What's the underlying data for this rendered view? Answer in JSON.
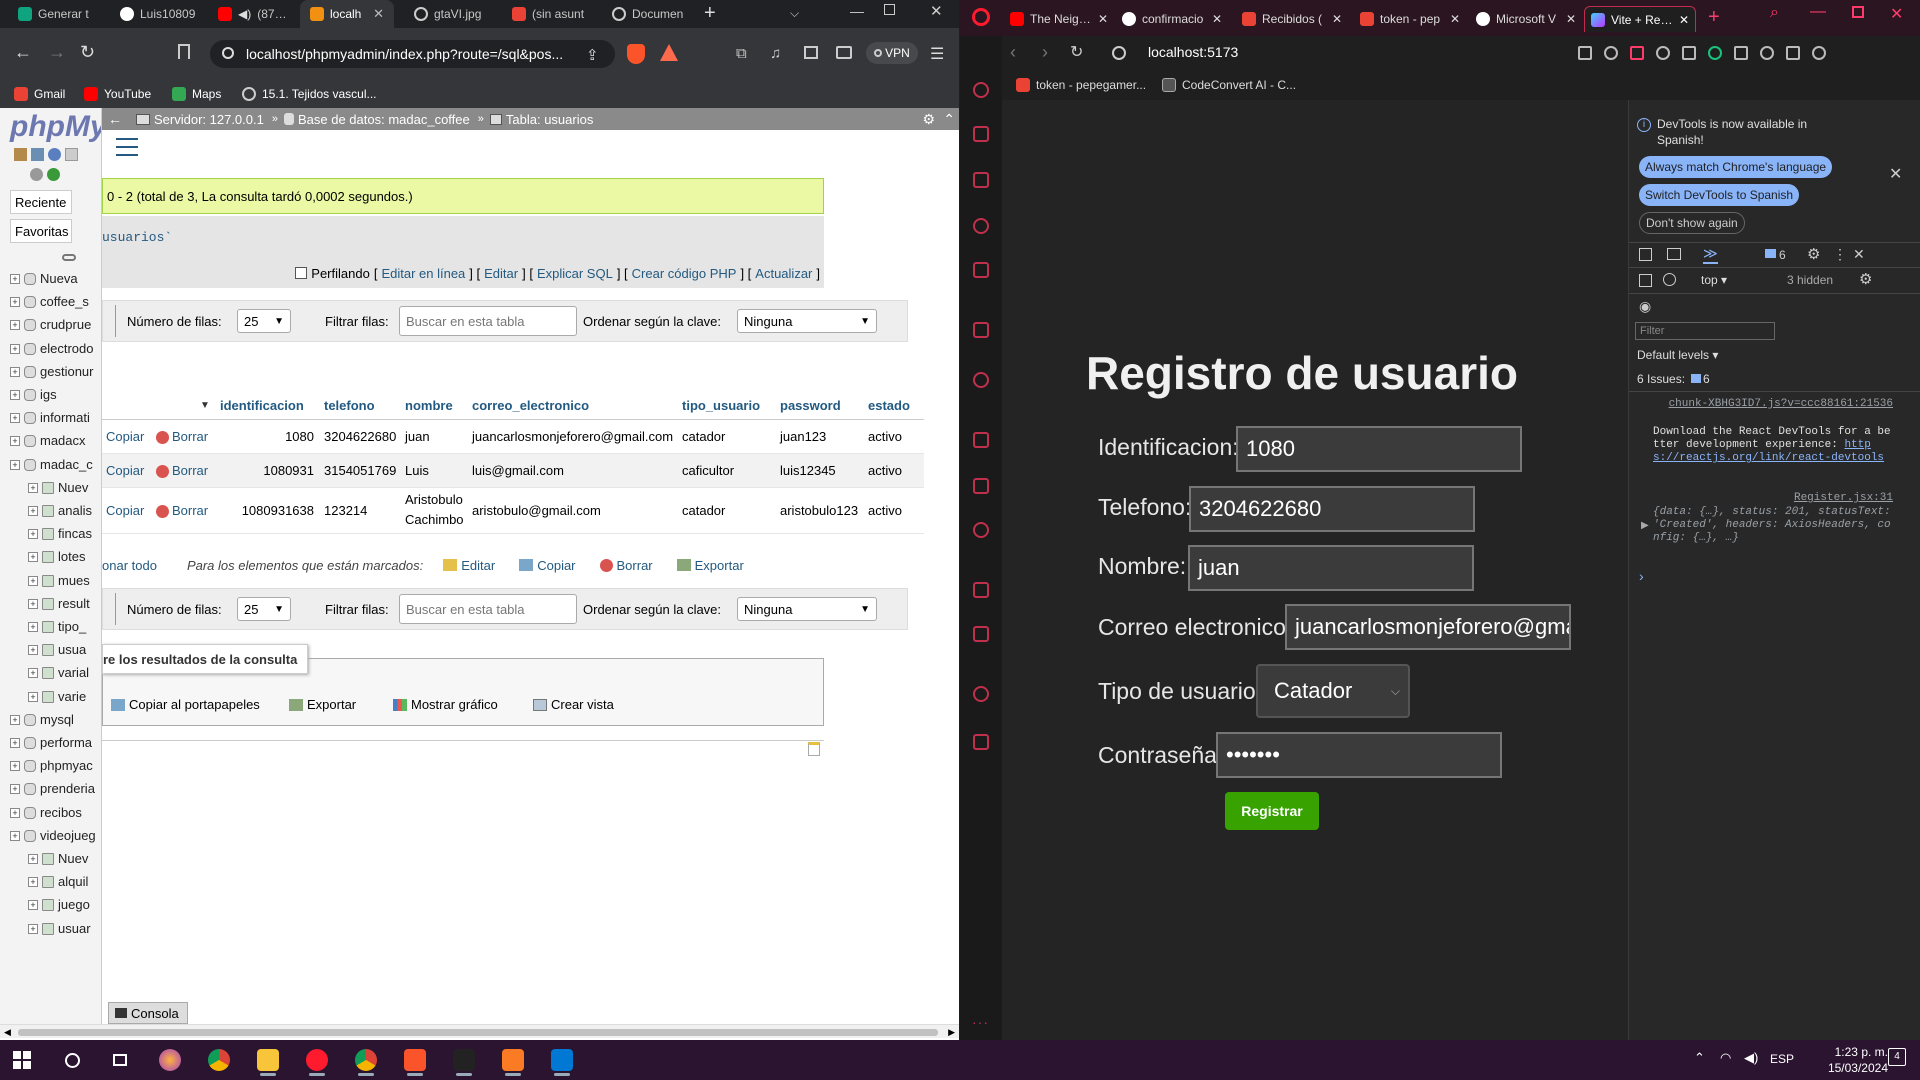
{
  "left_browser": {
    "tabs": [
      {
        "title": "Generar t"
      },
      {
        "title": "Luis10809"
      },
      {
        "title": "(87) P"
      },
      {
        "title": "localh"
      },
      {
        "title": "gtaVI.jpg"
      },
      {
        "title": "(sin asunt"
      },
      {
        "title": "Documen"
      }
    ],
    "address": "localhost/phpmyadmin/index.php?route=/sql&pos...",
    "vpn_label": "VPN",
    "bookmarks": [
      "Gmail",
      "YouTube",
      "Maps",
      "15.1. Tejidos vascul..."
    ]
  },
  "pma": {
    "logo": "phpMy",
    "nav_buttons": [
      "Reciente",
      "Favoritas"
    ],
    "tree": [
      {
        "label": "Nueva",
        "level": 0
      },
      {
        "label": "coffee_s",
        "level": 0
      },
      {
        "label": "crudprue",
        "level": 0
      },
      {
        "label": "electrodo",
        "level": 0
      },
      {
        "label": "gestionur",
        "level": 0
      },
      {
        "label": "igs",
        "level": 0
      },
      {
        "label": "informati",
        "level": 0
      },
      {
        "label": "madacx",
        "level": 0
      },
      {
        "label": "madac_c",
        "level": 0
      },
      {
        "label": "Nuev",
        "level": 1
      },
      {
        "label": "analis",
        "level": 1
      },
      {
        "label": "fincas",
        "level": 1
      },
      {
        "label": "lotes",
        "level": 1
      },
      {
        "label": "mues",
        "level": 1
      },
      {
        "label": "result",
        "level": 1
      },
      {
        "label": "tipo_",
        "level": 1
      },
      {
        "label": "usua",
        "level": 1
      },
      {
        "label": "varial",
        "level": 1
      },
      {
        "label": "varie",
        "level": 1
      },
      {
        "label": "mysql",
        "level": 0
      },
      {
        "label": "performa",
        "level": 0
      },
      {
        "label": "phpmyac",
        "level": 0
      },
      {
        "label": "prenderia",
        "level": 0
      },
      {
        "label": "recibos",
        "level": 0
      },
      {
        "label": "videojueg",
        "level": 0
      },
      {
        "label": "Nuev",
        "level": 1
      },
      {
        "label": "alquil",
        "level": 1
      },
      {
        "label": "juego",
        "level": 1
      },
      {
        "label": "usuar",
        "level": 1
      }
    ],
    "breadcrumb": {
      "server": "Servidor: 127.0.0.1",
      "database": "Base de datos: madac_coffee",
      "table": "Tabla: usuarios"
    },
    "success_message": "0 - 2 (total de 3, La consulta tardó 0,0002 segundos.)",
    "sql_text": "usuarios`",
    "profiling_label": "Perfilando",
    "sql_links": [
      "Editar en línea",
      "Editar",
      "Explicar SQL",
      "Crear código PHP",
      "Actualizar"
    ],
    "controls": {
      "rows_label": "Número de filas:",
      "rows_value": "25",
      "filter_label": "Filtrar filas:",
      "filter_placeholder": "Buscar en esta tabla",
      "sort_label": "Ordenar según la clave:",
      "sort_value": "Ninguna"
    },
    "columns": [
      "identificacion",
      "telefono",
      "nombre",
      "correo_electronico",
      "tipo_usuario",
      "password",
      "estado"
    ],
    "rows": [
      {
        "copy": "Copiar",
        "delete": "Borrar",
        "identificacion": "1080",
        "telefono": "3204622680",
        "nombre": "juan",
        "nombre2": "",
        "correo": "juancarlosmonjeforero@gmail.com",
        "tipo": "catador",
        "password": "juan123",
        "estado": "activo"
      },
      {
        "copy": "Copiar",
        "delete": "Borrar",
        "identificacion": "1080931",
        "telefono": "3154051769",
        "nombre": "Luis",
        "nombre2": "",
        "correo": "luis@gmail.com",
        "tipo": "caficultor",
        "password": "luis12345",
        "estado": "activo"
      },
      {
        "copy": "Copiar",
        "delete": "Borrar",
        "identificacion": "1080931638",
        "telefono": "123214",
        "nombre": "Aristobulo",
        "nombre2": "Cachimbo",
        "correo": "aristobulo@gmail.com",
        "tipo": "catador",
        "password": "aristobulo123",
        "estado": "activo"
      }
    ],
    "bulk": {
      "select_all": "onar todo",
      "marked_label": "Para los elementos que están marcados:",
      "edit": "Editar",
      "copy": "Copiar",
      "delete": "Borrar",
      "export": "Exportar"
    },
    "ops": {
      "title": "re los resultados de la consulta",
      "copy_clipboard": "Copiar al portapapeles",
      "export": "Exportar",
      "chart": "Mostrar gráfico",
      "view": "Crear vista"
    },
    "console_label": "Consola"
  },
  "right_browser": {
    "tabs": [
      {
        "title": "The Neighb"
      },
      {
        "title": "confirmacio"
      },
      {
        "title": "Recibidos ("
      },
      {
        "title": "token - pep"
      },
      {
        "title": "Microsoft V"
      },
      {
        "title": "Vite + React"
      }
    ],
    "address": "localhost:5173",
    "bookmarks": [
      "token - pepegamer...",
      "CodeConvert AI - C..."
    ]
  },
  "form": {
    "title": "Registro de usuario",
    "labels": {
      "id": "Identificacion:",
      "phone": "Telefono:",
      "name": "Nombre:",
      "email": "Correo electronico:",
      "type": "Tipo de usuario:",
      "password": "Contraseña:"
    },
    "values": {
      "id": "1080",
      "phone": "3204622680",
      "name": "juan",
      "email": "juancarlosmonjeforero@gmail.com",
      "type": "Catador",
      "password": "•••••••"
    },
    "submit": "Registrar"
  },
  "devtools": {
    "notice": "DevTools is now available in Spanish!",
    "btn_match": "Always match Chrome's language",
    "btn_switch": "Switch DevTools to Spanish",
    "btn_dont": "Don't show again",
    "msg_count": "6",
    "context": "top",
    "hidden": "3 hidden",
    "filter_placeholder": "Filter",
    "levels": "Default levels",
    "issues_label": "6 Issues:",
    "issues_count": "6",
    "log1_source": "chunk-XBHG3ID7.js?v=ccc88161:21536",
    "log1_text": "Download the React DevTools for a better development experience: ",
    "log1_link": "https://reactjs.org/link/react-devtools",
    "log2_source": "Register.jsx:31",
    "log2_text": "{data: {…}, status: 201, statusText: 'Created', headers: AxiosHeaders, config: {…}, …}"
  },
  "taskbar": {
    "lang": "ESP",
    "time": "1:23 p. m.",
    "date": "15/03/2024",
    "notif_count": "4"
  },
  "colors": {
    "pma_accent": "#235a81",
    "success_bg": "#ebf8a4",
    "register_btn": "#37a200",
    "opera_red": "#ff1b2d",
    "vscode_blue": "#0078d4"
  }
}
